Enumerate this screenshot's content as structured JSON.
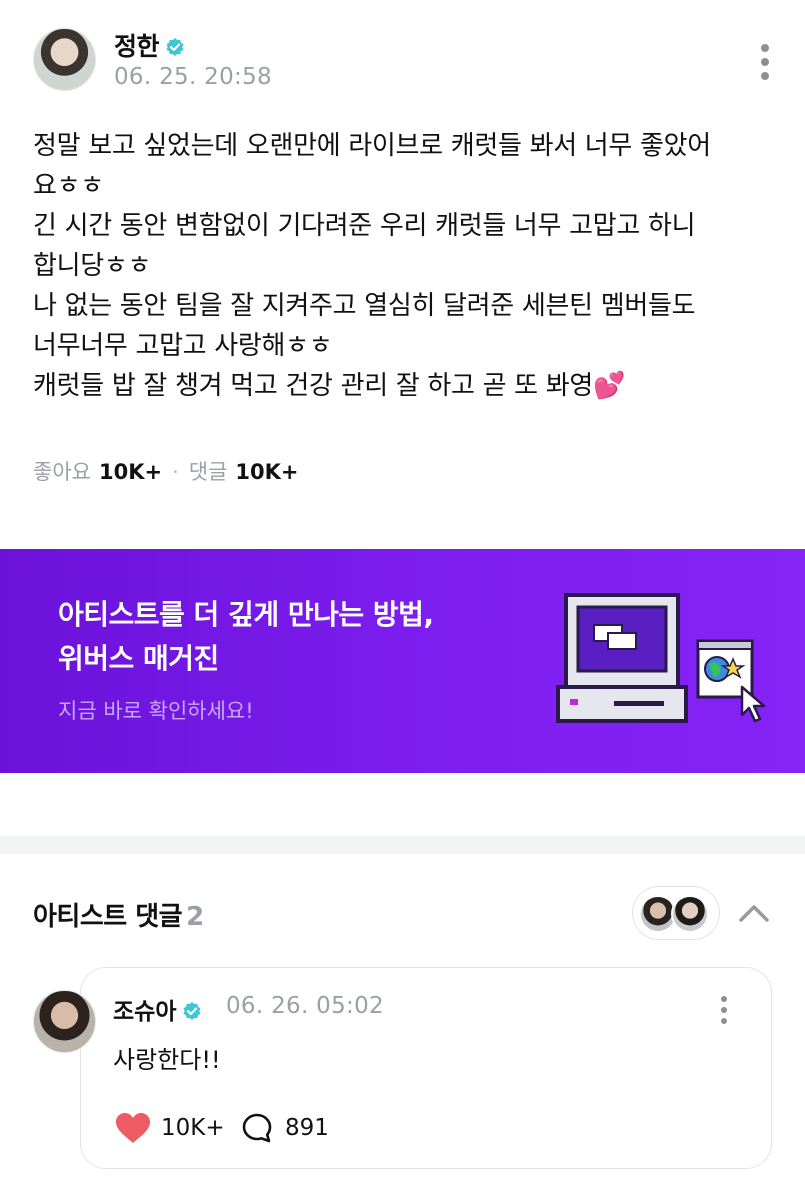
{
  "post": {
    "author": "정한",
    "timestamp": "06. 25. 20:58",
    "body_lines": [
      "정말 보고 싶었는데 오랜만에 라이브로 캐럿들 봐서 너무 좋았어",
      "요ㅎㅎ",
      "긴 시간 동안 변함없이 기다려준 우리 캐럿들 너무 고맙고 하니",
      "합니당ㅎㅎ",
      "나 없는 동안 팀을 잘 지켜주고 열심히 달려준 세븐틴 멤버들도",
      "너무너무 고맙고 사랑해ㅎㅎ",
      "캐럿들 밥 잘 챙겨 먹고 건강 관리 잘 하고 곧 또 봐영💕"
    ],
    "likes_label": "좋아요",
    "likes_count": "10K+",
    "separator": "·",
    "comments_label": "댓글",
    "comments_count": "10K+"
  },
  "banner": {
    "title_line1": "아티스트를 더 깊게 만나는 방법,",
    "title_line2": "위버스 매거진",
    "subtitle": "지금 바로 확인하세요!"
  },
  "artist_comments": {
    "title": "아티스트 댓글",
    "count": "2",
    "comment": {
      "author": "조슈아",
      "timestamp": "06. 26. 05:02",
      "text": "사랑한다!!",
      "like_count": "10K+",
      "reply_count": "891"
    }
  },
  "colors": {
    "verified": "#3fc6d6",
    "banner": "#7d1ef0",
    "heart": "#ee5b63"
  },
  "icons": [
    "verified-badge-icon",
    "more-vertical-icon",
    "chevron-up-icon",
    "heart-icon",
    "comment-bubble-icon"
  ]
}
